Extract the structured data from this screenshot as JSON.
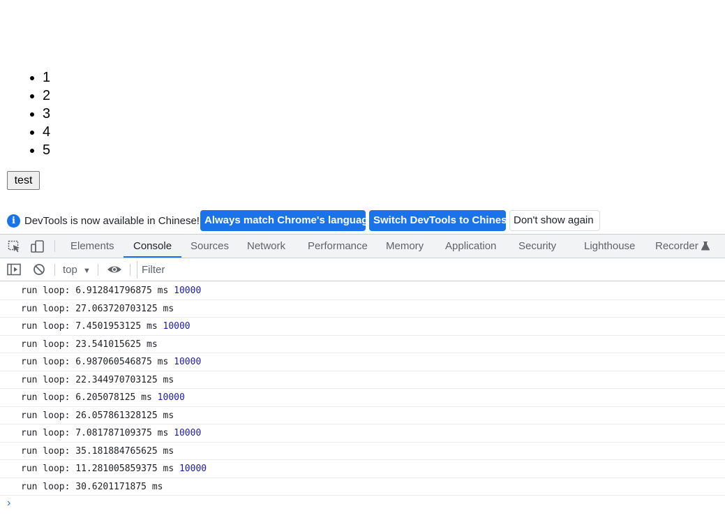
{
  "page": {
    "list_items": [
      "1",
      "2",
      "3",
      "4",
      "5"
    ],
    "button_label": "test"
  },
  "devtools": {
    "infobar": {
      "message": "DevTools is now available in Chinese!",
      "buttons": [
        "Always match Chrome's language",
        "Switch DevTools to Chinese",
        "Don't show again"
      ]
    },
    "tabs": [
      "Elements",
      "Console",
      "Sources",
      "Network",
      "Performance",
      "Memory",
      "Application",
      "Security",
      "Lighthouse",
      "Recorder"
    ],
    "active_tab": "Console",
    "toolbar": {
      "context": "top",
      "filter_placeholder": "Filter"
    },
    "console_rows": [
      {
        "text": "run loop: 6.912841796875 ms",
        "count": "10000"
      },
      {
        "text": "run loop: 27.063720703125 ms",
        "count": ""
      },
      {
        "text": "run loop: 7.4501953125 ms",
        "count": "10000"
      },
      {
        "text": "run loop: 23.541015625 ms",
        "count": ""
      },
      {
        "text": "run loop: 6.987060546875 ms",
        "count": "10000"
      },
      {
        "text": "run loop: 22.344970703125 ms",
        "count": ""
      },
      {
        "text": "run loop: 6.205078125 ms",
        "count": "10000"
      },
      {
        "text": "run loop: 26.057861328125 ms",
        "count": ""
      },
      {
        "text": "run loop: 7.081787109375 ms",
        "count": "10000"
      },
      {
        "text": "run loop: 35.181884765625 ms",
        "count": ""
      },
      {
        "text": "run loop: 11.281005859375 ms",
        "count": "10000"
      },
      {
        "text": "run loop: 30.6201171875 ms",
        "count": ""
      }
    ],
    "icons": {
      "inspect": "inspect-element-icon",
      "device": "device-toolbar-icon",
      "sidebar": "show-sidebar-icon",
      "clear": "clear-console-icon",
      "eye": "live-expression-icon",
      "experiment": "experiment-flask-icon",
      "prompt": "console-prompt-icon"
    },
    "colors": {
      "accent": "#1a73e8",
      "number": "#1a1aa6"
    }
  }
}
